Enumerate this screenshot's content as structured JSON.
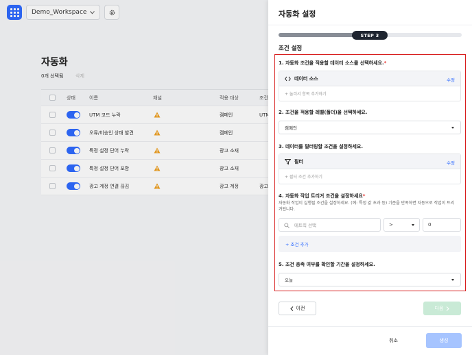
{
  "app": {
    "workspace": "Demo_Workspace"
  },
  "page": {
    "title": "자동화",
    "selected_count": "0개 선택됨",
    "delete_label": "삭제"
  },
  "table": {
    "headers": [
      "상태",
      "이름",
      "채널",
      "적용 대상",
      "조건"
    ],
    "rows": [
      {
        "name": "UTM 코드 누락",
        "target": "캠페인",
        "extra": "UTM"
      },
      {
        "name": "오류/비승인 상태 발견",
        "target": "캠페인",
        "extra": ""
      },
      {
        "name": "특정 설정 단어 누락",
        "target": "광고 소재",
        "extra": ""
      },
      {
        "name": "특정 설정 단어 포함",
        "target": "광고 소재",
        "extra": ""
      },
      {
        "name": "광고 계정 연결 끊김",
        "target": "광고 계정",
        "extra": "광고"
      }
    ]
  },
  "drawer": {
    "title": "자동화 설정",
    "step_label": "STEP 3",
    "progress": 0.55,
    "section_title": "조건 설정",
    "q1": {
      "label": "1. 자동화 조건을 적용할 데이터 소스를 선택하세요.",
      "required": "*",
      "card_title": "데이터 소스",
      "edit": "수정",
      "add": "+ 눌러서 항목 추가하기"
    },
    "q2": {
      "label": "2. 조건을 적용할 레벨(폴더)을 선택하세요.",
      "value": "캠페인"
    },
    "q3": {
      "label": "3. 데이터를 필터링할 조건을 설정하세요.",
      "card_title": "필터",
      "edit": "수정",
      "add": "+ 필터 조건 추가하기"
    },
    "q4": {
      "label": "4. 자동화 작업 트리거 조건을 설정하세요",
      "required": "*",
      "desc": "자동화 작업이 실행될 조건을 설정하세요. (예: 특정 값 초과 등) 기준을 만족하면 자동으로 작업이 트리거됩니다.",
      "metric_placeholder": "메트릭 선택",
      "operator": ">",
      "value": "0",
      "add_condition": "+ 조건 추가"
    },
    "q5": {
      "label": "5. 조건 충족 여부를 확인할 기간을 설정하세요.",
      "value": "오늘"
    },
    "prev": "이전",
    "next": "다음",
    "cancel": "취소",
    "create": "생성"
  },
  "colors": {
    "primary": "#2f6bff",
    "highlight_border": "#d81e1e",
    "warning": "#f0a020"
  }
}
